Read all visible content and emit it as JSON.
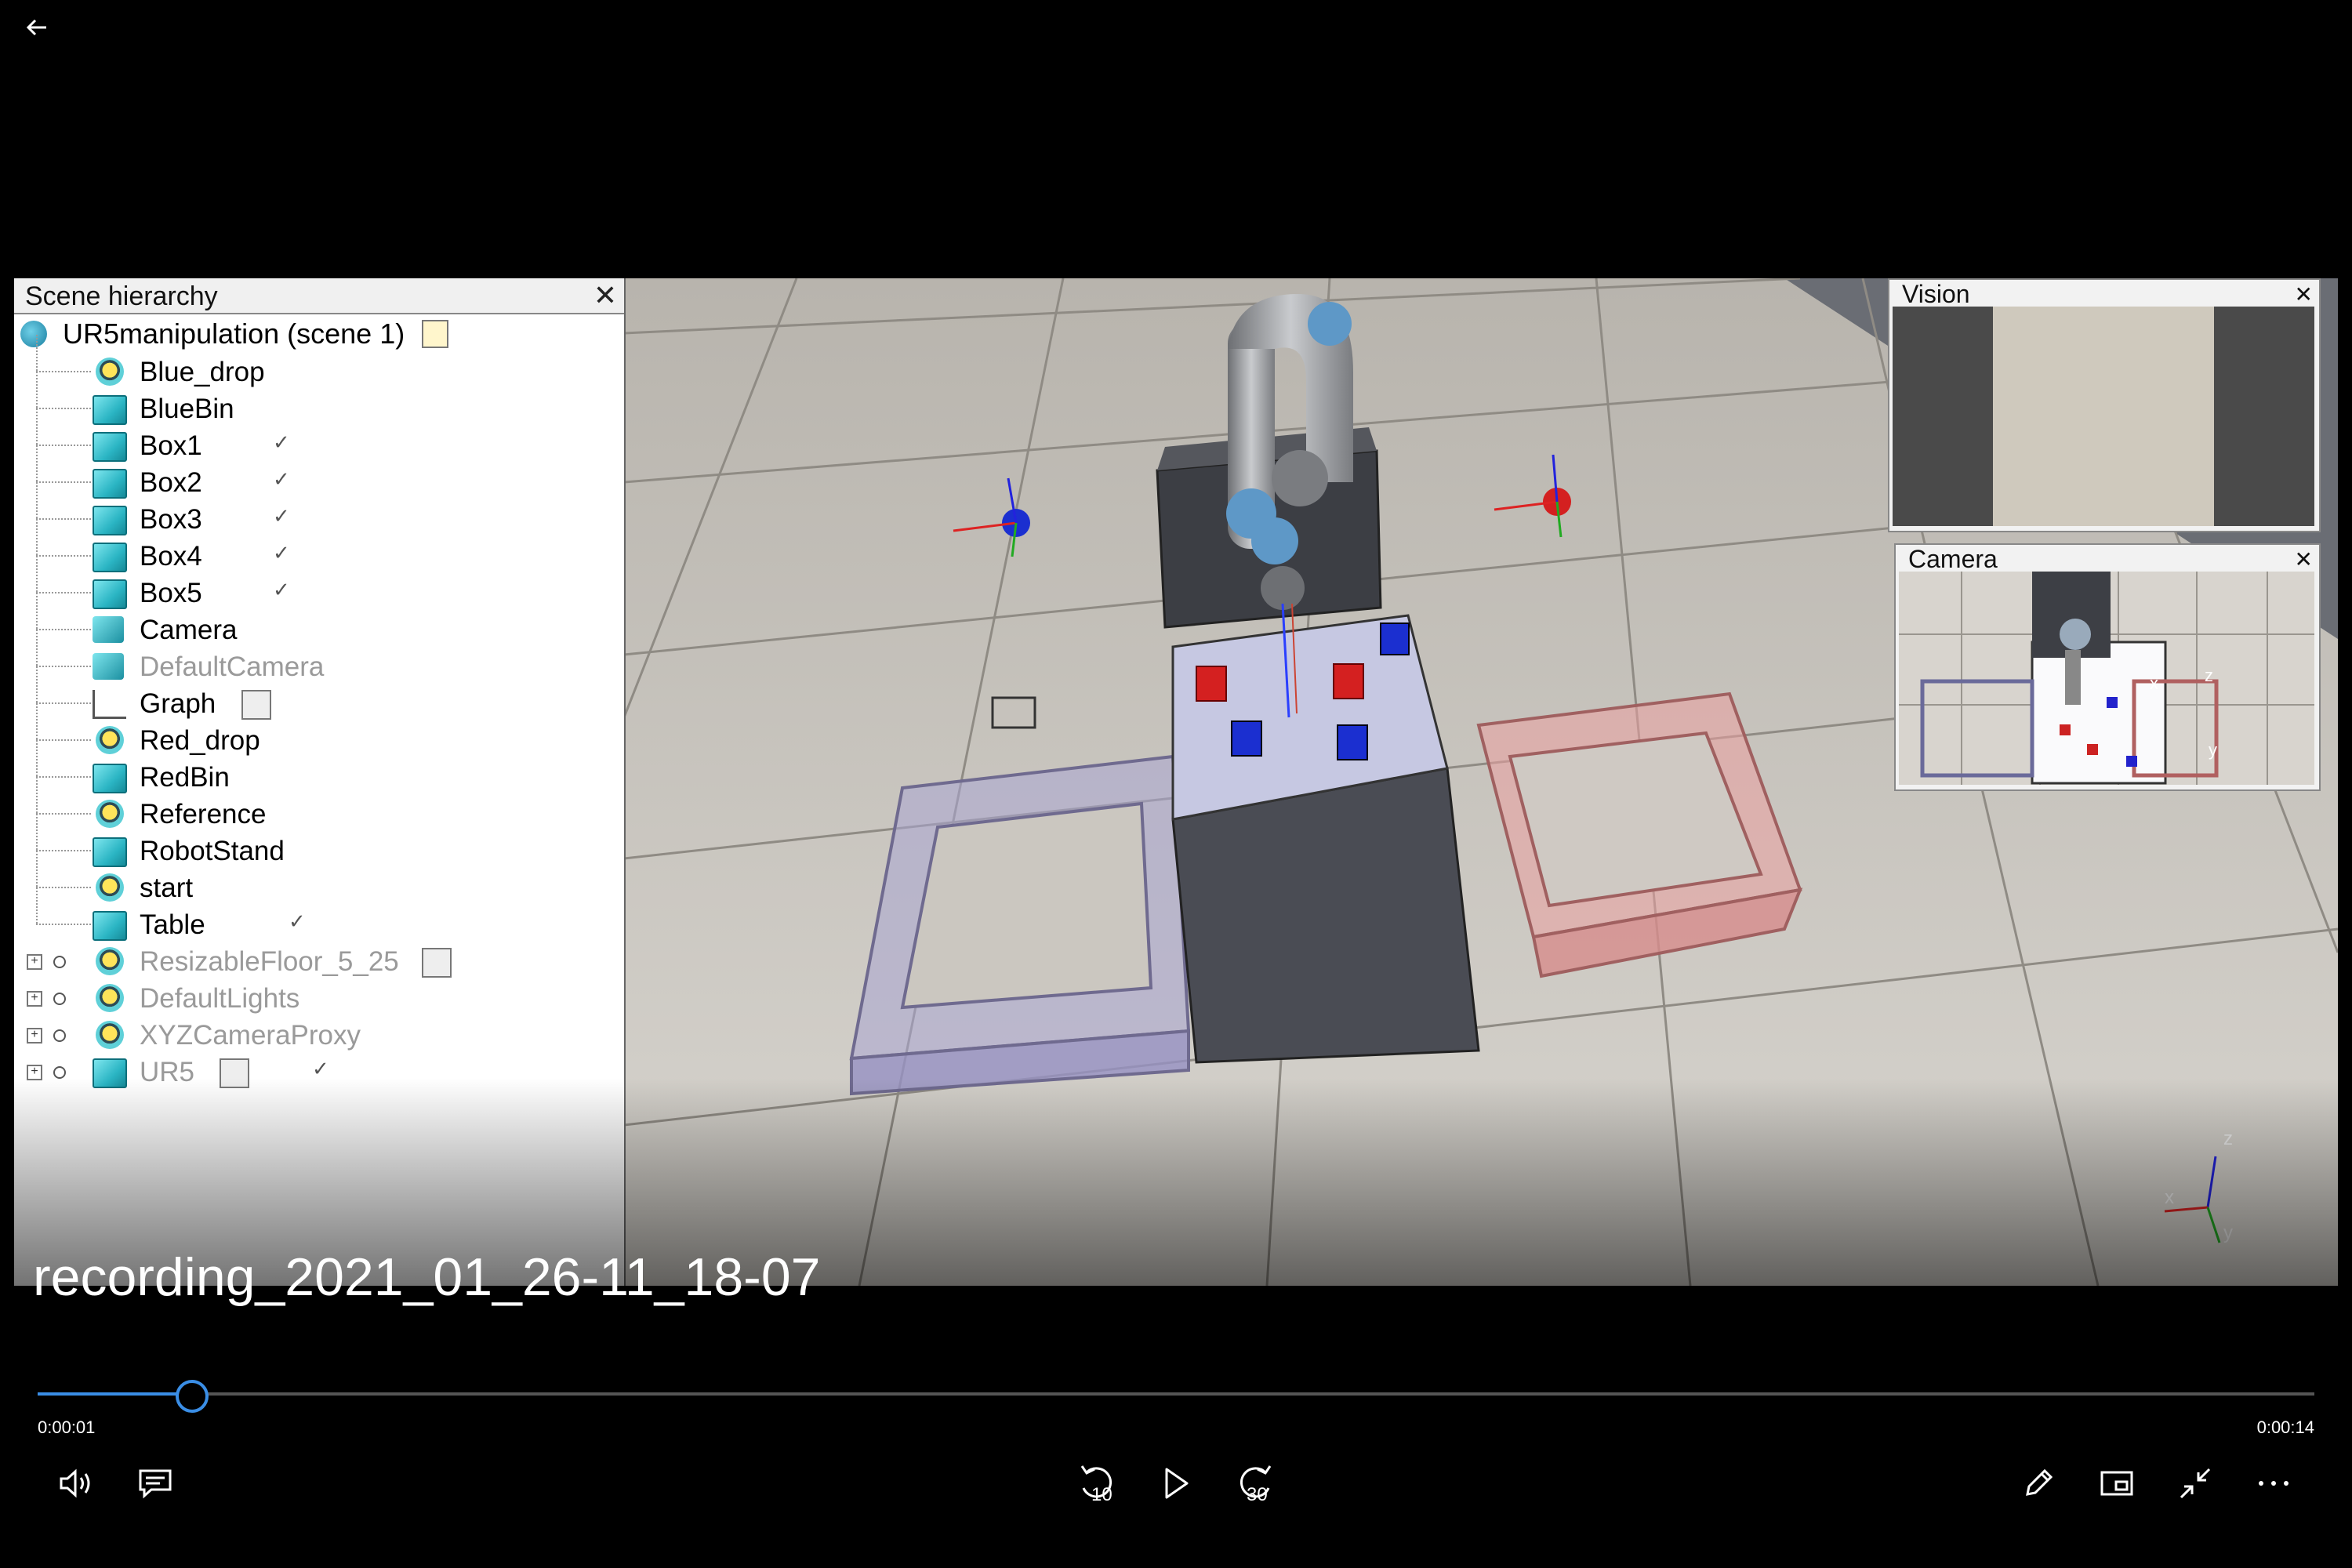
{
  "player": {
    "video_title": "recording_2021_01_26-11_18-07",
    "time_current": "0:00:01",
    "time_total": "0:00:14",
    "progress_fraction": 0.068,
    "accent_color": "#3a8ee6",
    "icons": {
      "back": "back-arrow-icon",
      "volume": "volume-icon",
      "subtitles": "subtitles-icon",
      "skip_back": "skip-back-10-icon",
      "play": "play-icon",
      "skip_forward": "skip-forward-30-icon",
      "edit": "pen-icon",
      "mini_view": "mini-view-icon",
      "exit_fullscreen": "exit-fullscreen-icon",
      "more": "more-icon"
    },
    "skip_back_label": "10",
    "skip_forward_label": "30"
  },
  "scene_hierarchy": {
    "title": "Scene hierarchy",
    "root_label": "UR5manipulation (scene 1)",
    "items": [
      {
        "label": "Blue_drop",
        "icon": "dummy-icon",
        "dim": false
      },
      {
        "label": "BlueBin",
        "icon": "shape-group-icon",
        "dim": false
      },
      {
        "label": "Box1",
        "icon": "cube-icon",
        "dim": false
      },
      {
        "label": "Box2",
        "icon": "cube-icon",
        "dim": false
      },
      {
        "label": "Box3",
        "icon": "cube-icon",
        "dim": false
      },
      {
        "label": "Box4",
        "icon": "cube-icon",
        "dim": false
      },
      {
        "label": "Box5",
        "icon": "cube-icon",
        "dim": false
      },
      {
        "label": "Camera",
        "icon": "camera-icon",
        "dim": false
      },
      {
        "label": "DefaultCamera",
        "icon": "camera-icon",
        "dim": true
      },
      {
        "label": "Graph",
        "icon": "graph-icon",
        "dim": false
      },
      {
        "label": "Red_drop",
        "icon": "dummy-icon",
        "dim": false
      },
      {
        "label": "RedBin",
        "icon": "shape-group-icon",
        "dim": false
      },
      {
        "label": "Reference",
        "icon": "dummy-icon",
        "dim": false
      },
      {
        "label": "RobotStand",
        "icon": "cube-icon",
        "dim": false
      },
      {
        "label": "start",
        "icon": "dummy-icon",
        "dim": false
      },
      {
        "label": "Table",
        "icon": "cube-icon",
        "dim": false
      },
      {
        "label": "ResizableFloor_5_25",
        "icon": "dummy-icon",
        "dim": true
      },
      {
        "label": "DefaultLights",
        "icon": "dummy-icon",
        "dim": true
      },
      {
        "label": "XYZCameraProxy",
        "icon": "dummy-icon",
        "dim": true
      },
      {
        "label": "UR5",
        "icon": "shape-group-icon",
        "dim": true
      }
    ]
  },
  "vision_window": {
    "title": "Vision"
  },
  "camera_window": {
    "title": "Camera",
    "axis_labels": [
      "x",
      "z",
      "y"
    ]
  },
  "axis_gizmo": {
    "labels": [
      "z",
      "x",
      "y"
    ]
  }
}
